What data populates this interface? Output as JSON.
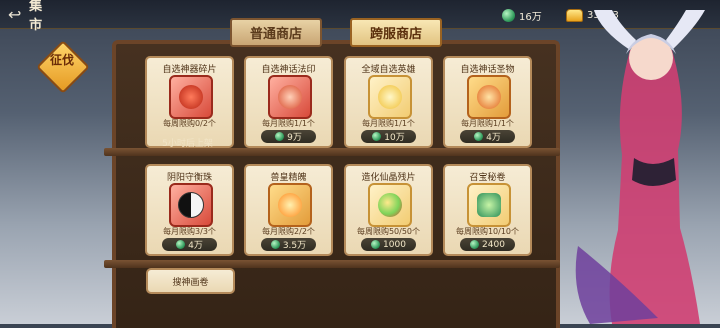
{
  "header": {
    "back_icon": "back-arrow-icon",
    "title": "集市"
  },
  "resources": {
    "jade": {
      "icon": "jade-icon",
      "value": "16万"
    },
    "gold": {
      "icon": "gold-ingot-icon",
      "value": "33483"
    }
  },
  "side_tab": {
    "label": "征伐"
  },
  "tabs": [
    {
      "label": "普通商店",
      "active": false
    },
    {
      "label": "跨服商店",
      "active": true
    }
  ],
  "items": [
    {
      "name": "自选神器碎片",
      "limit": "每周限购0/2个",
      "restock": "5小时后上架"
    },
    {
      "name": "自选神话法印",
      "limit": "每月限购1/1个",
      "price": "9万"
    },
    {
      "name": "全域自选英雄",
      "limit": "每月限购1/1个",
      "price": "10万"
    },
    {
      "name": "自选神话圣物",
      "limit": "每月限购1/1个",
      "price": "4万"
    },
    {
      "name": "阴阳守衡珠",
      "limit": "每月限购3/3个",
      "price": "4万"
    },
    {
      "name": "兽皇精魄",
      "limit": "每月限购2/2个",
      "price": "3.5万"
    },
    {
      "name": "造化仙晶残片",
      "limit": "每周限购50/50个",
      "price": "1000"
    },
    {
      "name": "召宝秘卷",
      "limit": "每周限购10/10个",
      "price": "2400"
    },
    {
      "name": "搜神画卷"
    }
  ],
  "colors": {
    "accent": "#e2c482",
    "jade": "#2f9a5b",
    "gold": "#e8a31d"
  }
}
